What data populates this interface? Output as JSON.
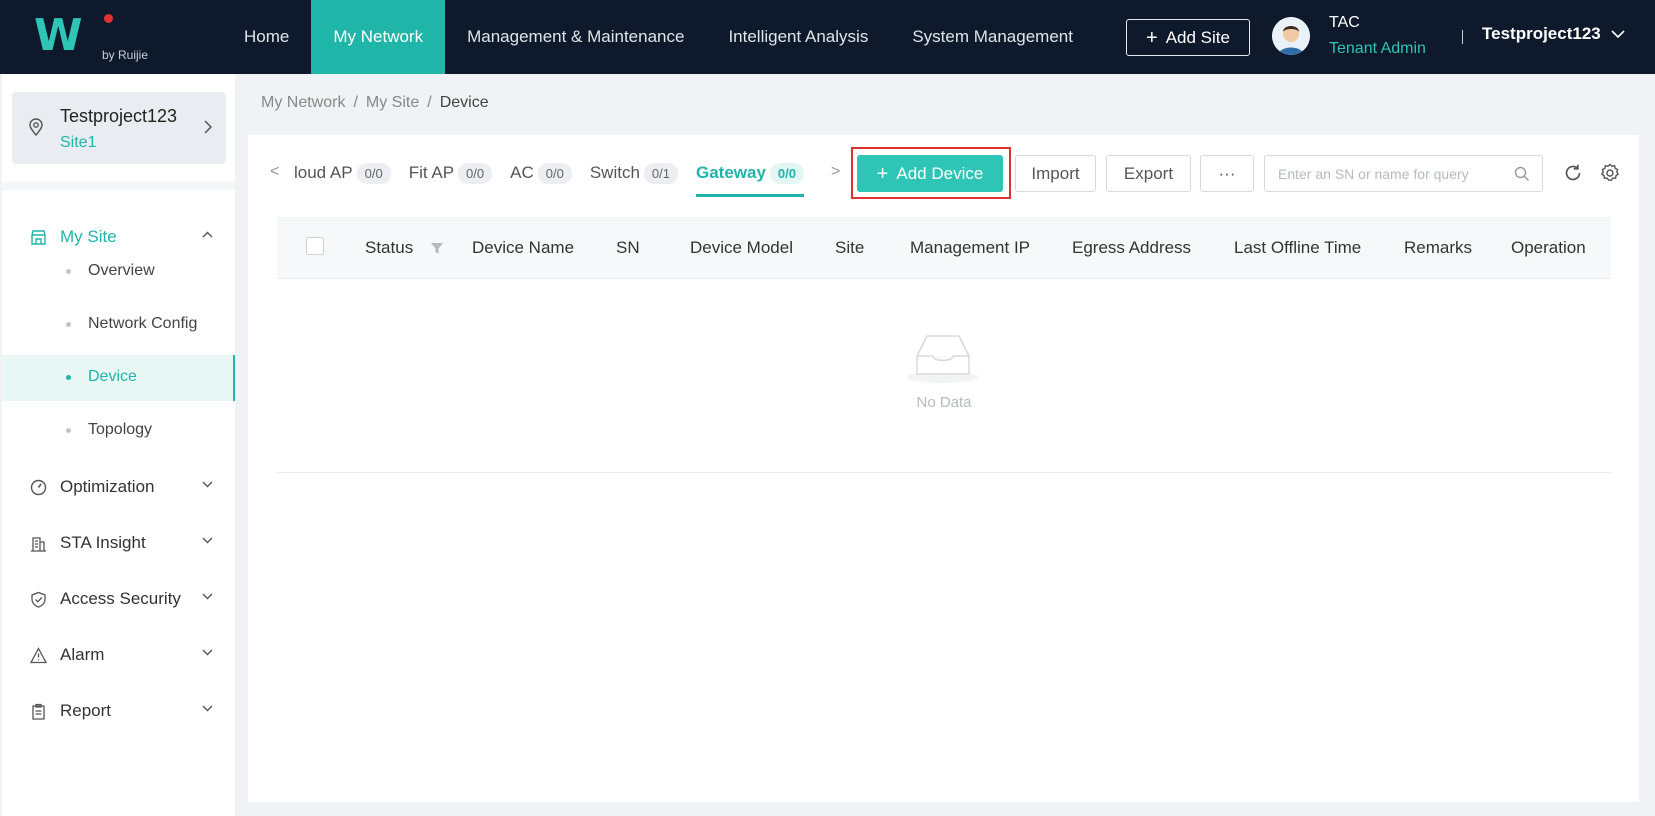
{
  "brand": {
    "logo_text": "W",
    "sub": "by Ruijie"
  },
  "nav": {
    "items": [
      {
        "label": "Home"
      },
      {
        "label": "My Network",
        "active": true
      },
      {
        "label": "Management & Maintenance"
      },
      {
        "label": "Intelligent Analysis"
      },
      {
        "label": "System Management"
      }
    ],
    "add_site_label": "Add Site"
  },
  "user": {
    "name": "TAC",
    "role": "Tenant Admin",
    "project": "Testproject123"
  },
  "sidebar": {
    "site_name": "Testproject123",
    "site_sub": "Site1",
    "groups": {
      "my_site": "My Site",
      "optimization": "Optimization",
      "sta_insight": "STA Insight",
      "access_security": "Access Security",
      "alarm": "Alarm",
      "report": "Report"
    },
    "subitems": {
      "overview": "Overview",
      "network_config": "Network Config",
      "device": "Device",
      "topology": "Topology"
    }
  },
  "breadcrumb": {
    "l1": "My Network",
    "l2": "My Site",
    "l3": "Device",
    "sep": "/"
  },
  "tabs": [
    {
      "label": "loud AP",
      "count": "0/0"
    },
    {
      "label": "Fit AP",
      "count": "0/0"
    },
    {
      "label": "AC",
      "count": "0/0"
    },
    {
      "label": "Switch",
      "count": "0/1"
    },
    {
      "label": "Gateway",
      "count": "0/0",
      "active": true
    }
  ],
  "toolbar": {
    "add_device_label": "Add Device",
    "import_label": "Import",
    "export_label": "Export",
    "more_label": "···",
    "search_placeholder": "Enter an SN or name for query"
  },
  "table": {
    "columns": {
      "status": "Status",
      "device_name": "Device Name",
      "sn": "SN",
      "device_model": "Device Model",
      "site": "Site",
      "management_ip": "Management IP",
      "egress_address": "Egress Address",
      "last_offline_time": "Last Offline Time",
      "remarks": "Remarks",
      "operation": "Operation"
    },
    "empty_text": "No Data"
  },
  "colors": {
    "accent": "#2ec4b6",
    "nav_bg": "#0e1a2b",
    "highlight": "#e03131"
  }
}
